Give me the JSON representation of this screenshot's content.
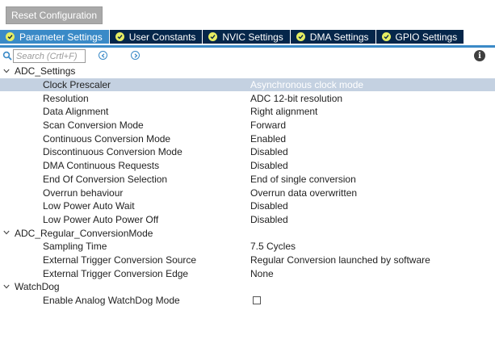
{
  "toolbar": {
    "reset_label": "Reset Configuration"
  },
  "tabs": [
    {
      "label": "Parameter Settings",
      "active": true
    },
    {
      "label": "User Constants",
      "active": false
    },
    {
      "label": "NVIC Settings",
      "active": false
    },
    {
      "label": "DMA Settings",
      "active": false
    },
    {
      "label": "GPIO Settings",
      "active": false
    }
  ],
  "search": {
    "placeholder": "Search (Crtl+F)",
    "icon": "search-icon",
    "prev_icon": "chevron-left-icon",
    "next_icon": "chevron-right-icon",
    "info_icon": "info-icon"
  },
  "groups": [
    {
      "title": "ADC_Settings",
      "params": [
        {
          "name": "Clock Prescaler",
          "value": "Asynchronous clock mode",
          "selected": true
        },
        {
          "name": "Resolution",
          "value": "ADC 12-bit resolution"
        },
        {
          "name": "Data Alignment",
          "value": "Right alignment"
        },
        {
          "name": "Scan Conversion Mode",
          "value": "Forward"
        },
        {
          "name": "Continuous Conversion Mode",
          "value": "Enabled"
        },
        {
          "name": "Discontinuous Conversion Mode",
          "value": "Disabled"
        },
        {
          "name": "DMA Continuous Requests",
          "value": "Disabled"
        },
        {
          "name": "End Of Conversion Selection",
          "value": "End of single conversion"
        },
        {
          "name": "Overrun behaviour",
          "value": "Overrun data overwritten"
        },
        {
          "name": "Low Power Auto Wait",
          "value": "Disabled"
        },
        {
          "name": "Low Power Auto Power Off",
          "value": "Disabled"
        }
      ]
    },
    {
      "title": "ADC_Regular_ConversionMode",
      "params": [
        {
          "name": "Sampling Time",
          "value": "7.5 Cycles"
        },
        {
          "name": "External Trigger Conversion Source",
          "value": "Regular Conversion launched by software"
        },
        {
          "name": "External Trigger Conversion Edge",
          "value": "None"
        }
      ]
    },
    {
      "title": "WatchDog",
      "params": [
        {
          "name": "Enable Analog WatchDog Mode",
          "checkbox": true,
          "checked": false
        }
      ]
    }
  ],
  "colors": {
    "tab_active": "#3a8ac7",
    "tab_inactive": "#05264a",
    "tab_check": "#e6ed63",
    "selected_row": "#c4d1e1",
    "reset_button": "#a9a9a9"
  }
}
